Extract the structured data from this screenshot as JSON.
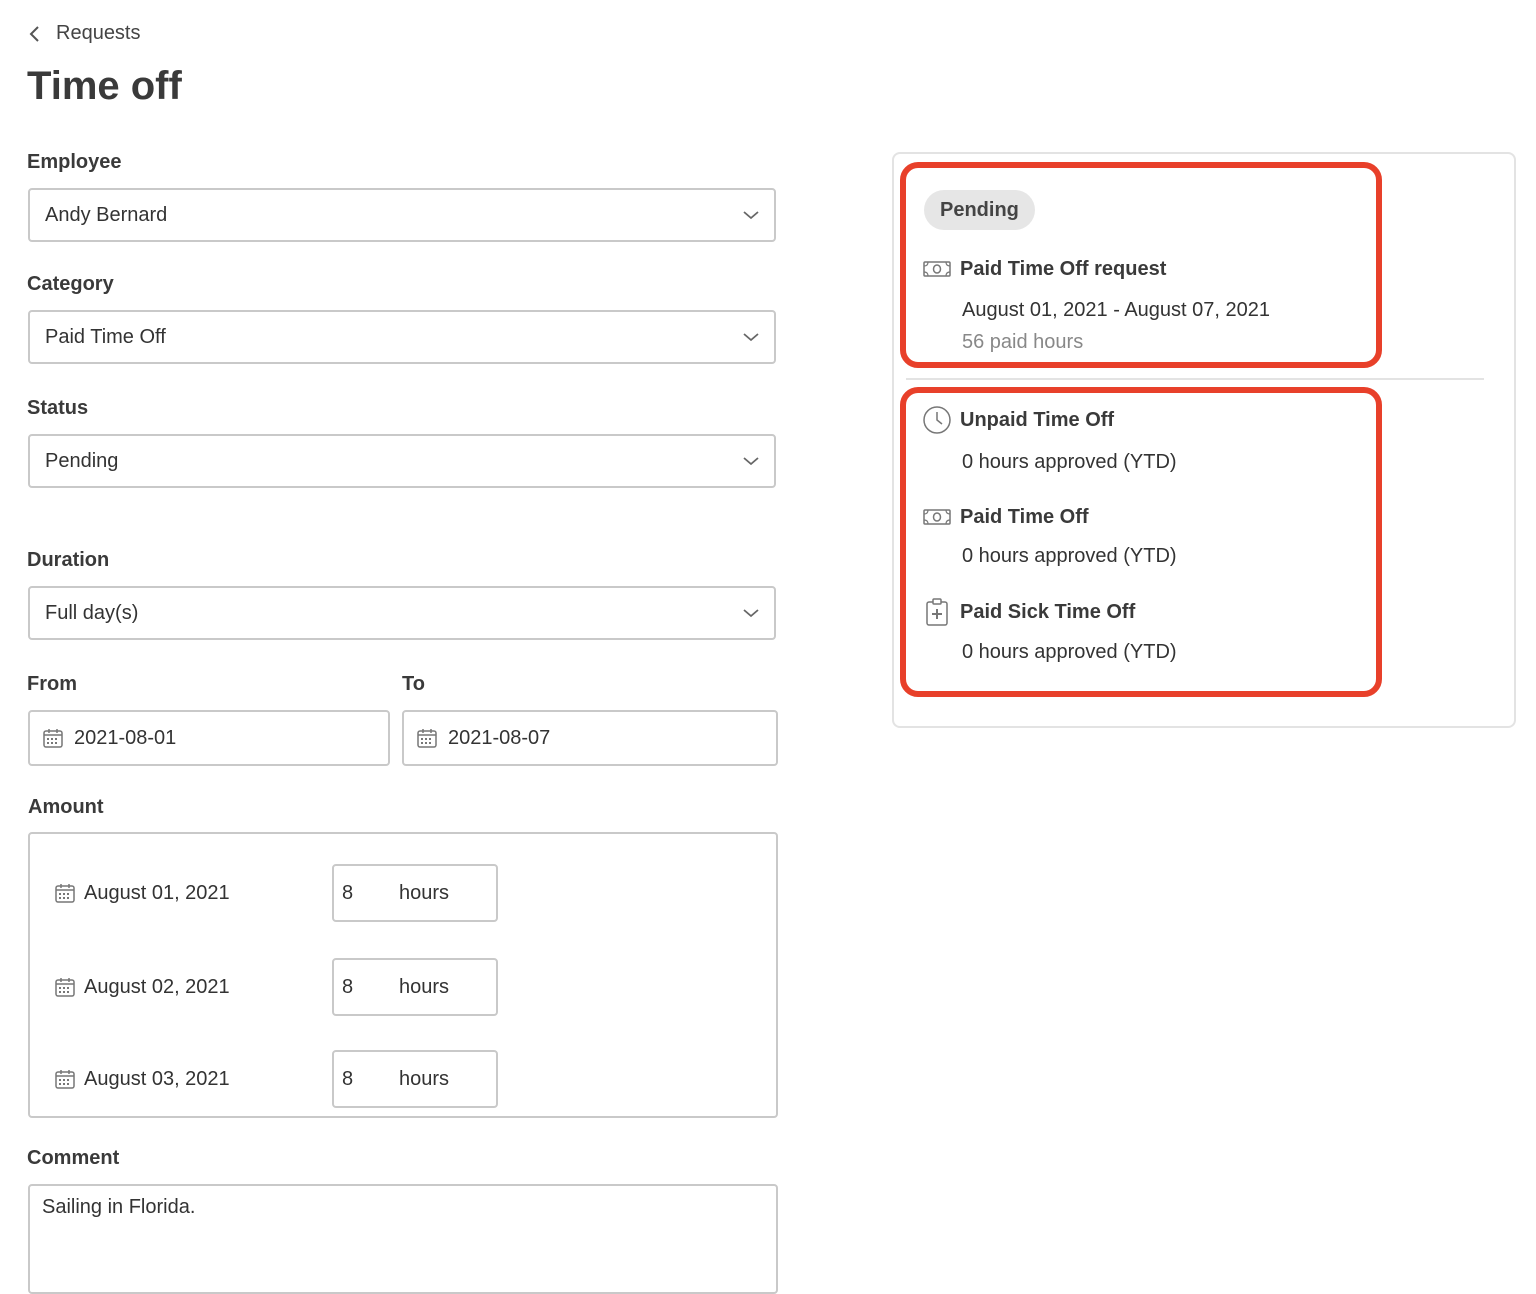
{
  "breadcrumb": {
    "label": "Requests"
  },
  "page": {
    "title": "Time off"
  },
  "form": {
    "employee": {
      "label": "Employee",
      "value": "Andy Bernard"
    },
    "category": {
      "label": "Category",
      "value": "Paid Time Off"
    },
    "status": {
      "label": "Status",
      "value": "Pending"
    },
    "duration": {
      "label": "Duration",
      "value": "Full day(s)"
    },
    "from": {
      "label": "From",
      "value": "2021-08-01"
    },
    "to": {
      "label": "To",
      "value": "2021-08-07"
    },
    "amount": {
      "label": "Amount",
      "unit": "hours",
      "rows": [
        {
          "date": "August 01, 2021",
          "hours": "8"
        },
        {
          "date": "August 02, 2021",
          "hours": "8"
        },
        {
          "date": "August 03, 2021",
          "hours": "8"
        }
      ]
    },
    "comment": {
      "label": "Comment",
      "value": "Sailing in Florida."
    }
  },
  "summary": {
    "status_badge": "Pending",
    "request": {
      "title": "Paid Time Off request",
      "date_range": "August 01, 2021 - August 07, 2021",
      "paid_hours": "56 paid hours"
    },
    "balances": [
      {
        "name": "Unpaid Time Off",
        "value": "0 hours approved (YTD)",
        "icon": "clock-icon"
      },
      {
        "name": "Paid Time Off",
        "value": "0 hours approved (YTD)",
        "icon": "money-icon"
      },
      {
        "name": "Paid Sick Time Off",
        "value": "0 hours approved (YTD)",
        "icon": "medical-clipboard-icon"
      }
    ]
  },
  "colors": {
    "highlight": "#e8402a",
    "border": "#c9c9c9",
    "badge_bg": "#e6e6e6"
  }
}
